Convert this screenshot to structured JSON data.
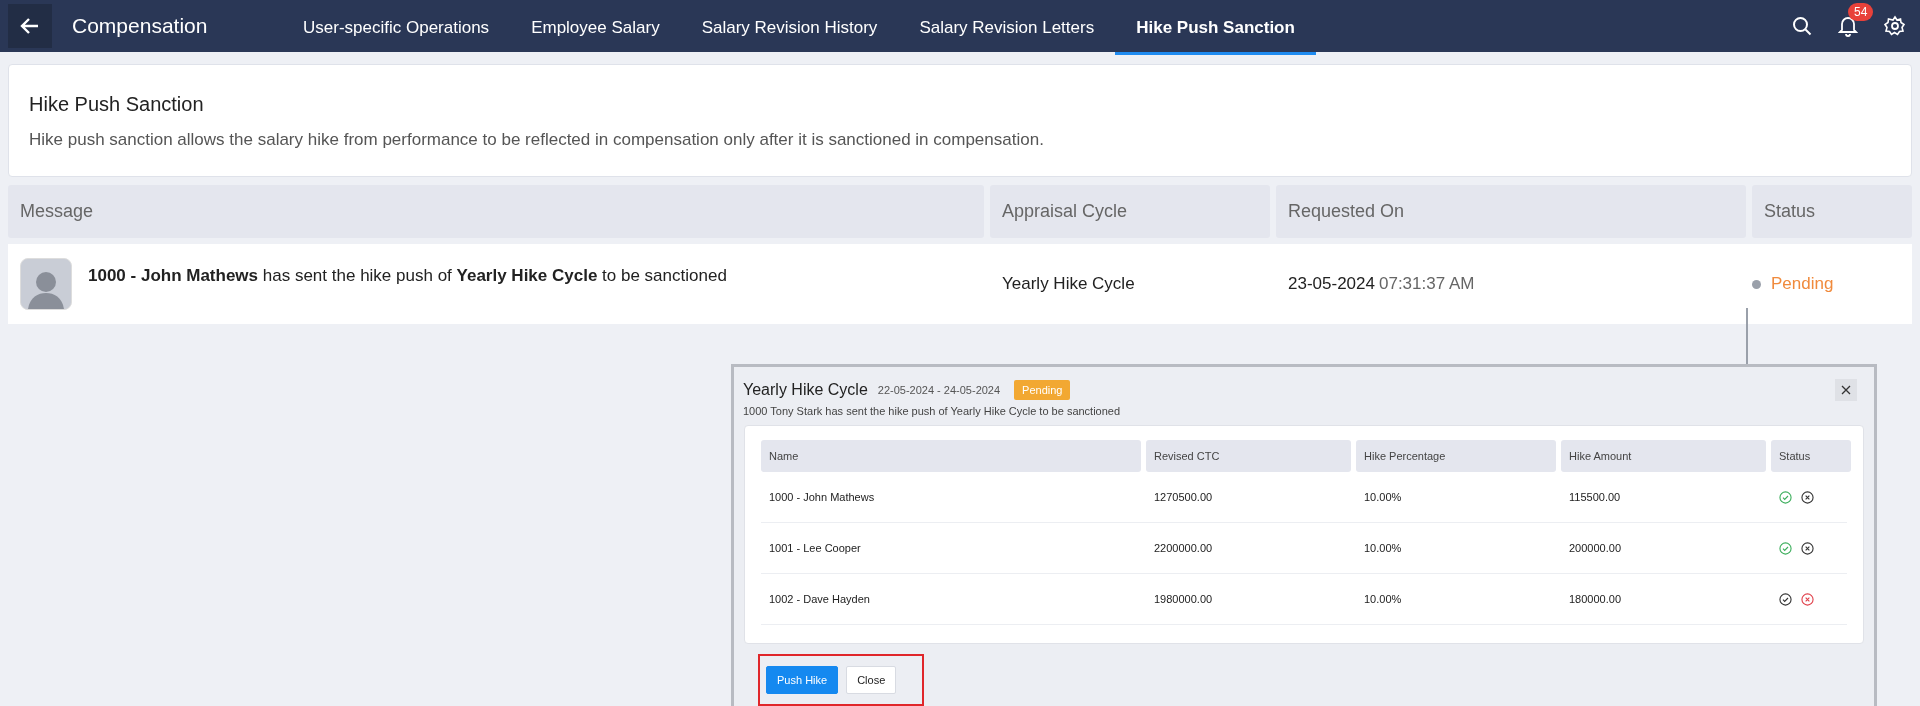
{
  "topbar": {
    "title": "Compensation",
    "tabs": [
      {
        "label": "User-specific Operations",
        "selected": false
      },
      {
        "label": "Employee Salary",
        "selected": false
      },
      {
        "label": "Salary Revision History",
        "selected": false
      },
      {
        "label": "Salary Revision Letters",
        "selected": false
      },
      {
        "label": "Hike Push Sanction",
        "selected": true
      }
    ],
    "notification_count": "54"
  },
  "intro": {
    "title": "Hike Push Sanction",
    "description": "Hike push sanction allows the salary hike from performance to be reflected in compensation only after it is sanctioned in compensation."
  },
  "table": {
    "columns": [
      "Message",
      "Appraisal Cycle",
      "Requested On",
      "Status"
    ],
    "rows": [
      {
        "message": "**1000 - John Mathews** has sent the hike push of **Yearly Hike Cycle** to be sanctioned",
        "appraisal_cycle": "Yearly Hike Cycle",
        "date": "23-05-2024",
        "time": "07:31:37 AM",
        "status": "Pending"
      }
    ]
  },
  "popup": {
    "title": "Yearly Hike Cycle",
    "period": "22-05-2024 - 24-05-2024",
    "badge": "Pending",
    "subtitle": "1000 Tony Stark has sent the hike push of Yearly Hike Cycle to be sanctioned",
    "columns": [
      "Name",
      "Revised CTC",
      "Hike Percentage",
      "Hike Amount",
      "Status"
    ],
    "rows": [
      {
        "name": "1000 - John Mathews",
        "revised_ctc": "1270500.00",
        "hike_percentage": "10.00%",
        "hike_amount": "115500.00",
        "approved": true
      },
      {
        "name": "1001 - Lee Cooper",
        "revised_ctc": "2200000.00",
        "hike_percentage": "10.00%",
        "hike_amount": "200000.00",
        "approved": true
      },
      {
        "name": "1002 - Dave Hayden",
        "revised_ctc": "1980000.00",
        "hike_percentage": "10.00%",
        "hike_amount": "180000.00",
        "approved": false
      }
    ],
    "buttons": [
      {
        "label": "Push Hike",
        "kind": "primary"
      },
      {
        "label": "Close",
        "kind": "secondary"
      }
    ]
  }
}
